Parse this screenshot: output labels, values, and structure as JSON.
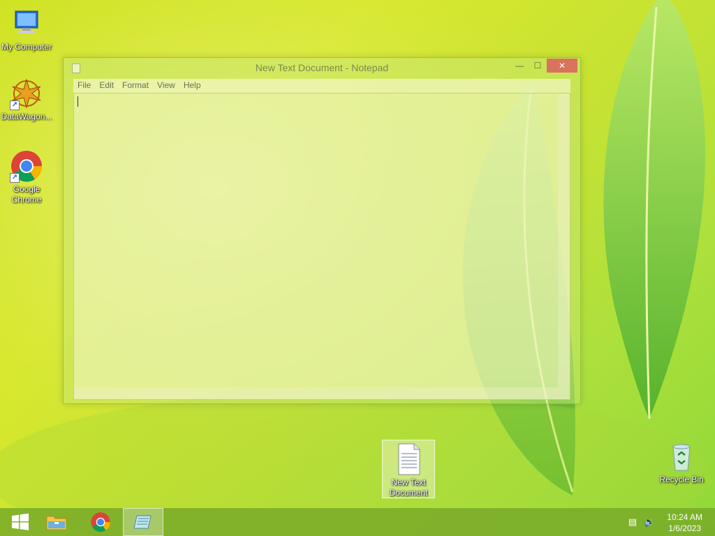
{
  "desktop": {
    "icons": [
      {
        "label": "My Computer"
      },
      {
        "label": "DataWagon..."
      },
      {
        "label": "Google Chrome"
      },
      {
        "label": "New Text Document"
      },
      {
        "label": "Recycle Bin"
      }
    ]
  },
  "notepad": {
    "title": "New Text Document - Notepad",
    "menu": [
      "File",
      "Edit",
      "Format",
      "View",
      "Help"
    ],
    "content": ""
  },
  "taskbar": {
    "clock_time": "10:24 AM",
    "clock_date": "1/6/2023",
    "icons": [
      "start-icon",
      "file-explorer-icon",
      "chrome-icon",
      "notepad-icon",
      "network-icon",
      "volume-icon"
    ]
  }
}
